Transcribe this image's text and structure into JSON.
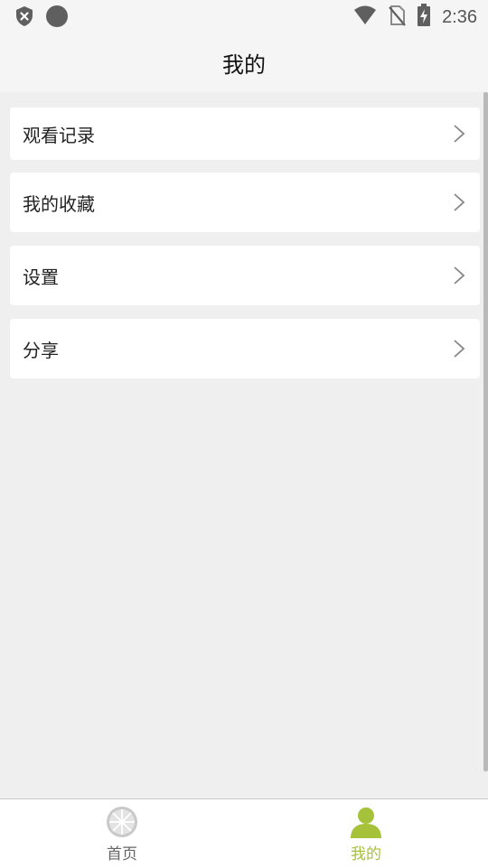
{
  "status_bar": {
    "time": "2:36",
    "icons": [
      "shield-x-icon",
      "record-dot-icon",
      "wifi-icon",
      "no-sim-icon",
      "battery-charging-icon"
    ]
  },
  "header": {
    "title": "我的"
  },
  "menu": {
    "items": [
      {
        "label": "观看记录",
        "icon": "chevron-right-icon"
      },
      {
        "label": "我的收藏",
        "icon": "chevron-right-icon"
      },
      {
        "label": "设置",
        "icon": "chevron-right-icon"
      },
      {
        "label": "分享",
        "icon": "chevron-right-icon"
      }
    ]
  },
  "bottom_nav": {
    "tabs": [
      {
        "label": "首页",
        "icon": "lemon-slice-icon",
        "active": false
      },
      {
        "label": "我的",
        "icon": "person-icon",
        "active": true
      }
    ],
    "active_color": "#a6c23a",
    "inactive_color": "#666666"
  }
}
